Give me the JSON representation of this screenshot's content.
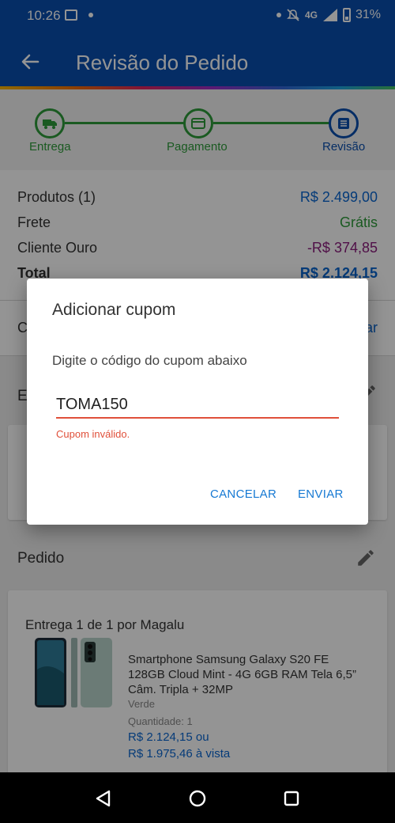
{
  "status_bar": {
    "time": "10:26",
    "network": "4G",
    "battery": "31%"
  },
  "app_bar": {
    "title": "Revisão do Pedido"
  },
  "steps": [
    {
      "label": "Entrega",
      "icon": "truck-icon"
    },
    {
      "label": "Pagamento",
      "icon": "card-icon"
    },
    {
      "label": "Revisão",
      "icon": "list-icon"
    }
  ],
  "summary": {
    "products_label": "Produtos (1)",
    "products_value": "R$ 2.499,00",
    "shipping_label": "Frete",
    "shipping_value": "Grátis",
    "gold_label": "Cliente Ouro",
    "gold_value": "-R$ 374,85",
    "total_label": "Total",
    "total_value": "R$ 2.124,15"
  },
  "coupon_row": {
    "label": "C",
    "action": "ar"
  },
  "delivery": {
    "title": "E"
  },
  "order": {
    "title": "Pedido",
    "shipment": "Entrega 1 de 1 por Magalu",
    "product_name": "Smartphone Samsung Galaxy S20 FE 128GB Cloud Mint - 4G 6GB RAM Tela 6,5” Câm. Tripla + 32MP",
    "variant": "Verde",
    "quantity": "Quantidade: 1",
    "price": "R$ 2.124,15 ou",
    "cash_price": "R$ 1.975,46 à vista"
  },
  "dialog": {
    "title": "Adicionar cupom",
    "message": "Digite o código do cupom abaixo",
    "input_value": "TOMA150",
    "error": "Cupom inválido.",
    "cancel": "CANCELAR",
    "submit": "ENVIAR"
  },
  "colors": {
    "primary": "#0a4eae",
    "success": "#2e9b3a",
    "error": "#e0503a",
    "link": "#1679d3"
  }
}
